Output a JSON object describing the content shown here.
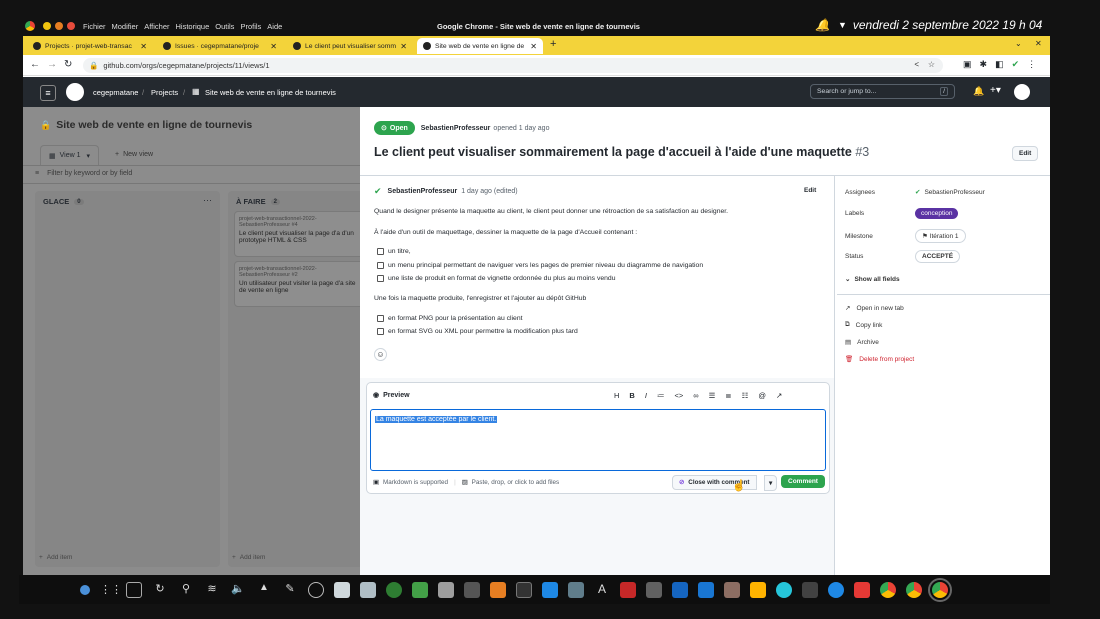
{
  "system": {
    "menu": [
      "Fichier",
      "Modifier",
      "Afficher",
      "Historique",
      "Outils",
      "Profils",
      "Aide"
    ],
    "window_title": "Google Chrome - Site web de vente en ligne de tournevis",
    "clock": "vendredi 2 septembre 2022  19 h 04"
  },
  "tabs": [
    {
      "label": "Projects · projet-web-transac"
    },
    {
      "label": "Issues · cegepmatane/proje"
    },
    {
      "label": "Le client peut visualiser somm"
    },
    {
      "label": "Site web de vente en ligne de"
    }
  ],
  "url": "github.com/orgs/cegepmatane/projects/11/views/1",
  "github": {
    "org": "cegepmatane",
    "crumb_projects": "Projects",
    "project_name": "Site web de vente en ligne de tournevis",
    "search_placeholder": "Search or jump to...",
    "search_key": "/"
  },
  "board": {
    "title": "Site web de vente en ligne de tournevis",
    "view_tab": "View 1",
    "new_view": "New view",
    "filter_placeholder": "Filter by keyword or by field",
    "columns": [
      {
        "name": "GLACE",
        "count": "0",
        "more": "···"
      },
      {
        "name": "À FAIRE",
        "count": "2"
      }
    ],
    "cards": [
      {
        "ref": "projet-web-transactionnel-2022-SebastienProfesseur #4",
        "title": "Le client peut visualiser la page d'a d'un prototype HTML & CSS"
      },
      {
        "ref": "projet-web-transactionnel-2022-SebastienProfesseur #2",
        "title": "Un utilisateur peut visiter la page d'a site de vente en ligne"
      }
    ],
    "add_item": "Add item"
  },
  "issue": {
    "state": "Open",
    "author": "SebastienProfesseur",
    "opened": "opened 1 day ago",
    "title": "Le client peut visualiser sommairement la page d'accueil à l'aide d'une maquette",
    "number": "#3",
    "edit": "Edit",
    "comment_author": "SebastienProfesseur",
    "comment_meta": "1 day ago (edited)",
    "comment_edit": "Edit",
    "body_intro": "Quand le designer présente la maquette au client, le client peut donner une rétroaction de sa satisfaction au designer.",
    "body_list_intro": "À l'aide d'un outil de maquettage, dessiner la maquette de la page d'Accueil contenant :",
    "tasks1": [
      "un titre,",
      "un menu principal permettant de naviguer vers les pages de premier niveau du diagramme de navigation",
      "une liste de produit en format de vignette ordonnée du plus au moins vendu"
    ],
    "body_after": "Une fois la maquette produite, l'enregistrer et l'ajouter au dépôt GitHub",
    "tasks2": [
      "en format PNG pour la présentation au client",
      "en format SVG ou XML pour permettre la modification plus tard"
    ]
  },
  "composer": {
    "tab": "Preview",
    "toolbar": [
      "H",
      "B",
      "I"
    ],
    "text": "La maquette est acceptée par le client.",
    "markdown_note": "Markdown is supported",
    "attach_note": "Paste, drop, or click to add files",
    "close_btn": "Close with comment",
    "comment_btn": "Comment"
  },
  "sidebar": {
    "fields": [
      {
        "key": "Assignees",
        "value": "SebastienProfesseur"
      },
      {
        "key": "Labels",
        "value": "conception"
      },
      {
        "key": "Milestone",
        "value": "Itération 1"
      },
      {
        "key": "Status",
        "value": "ACCEPTÉ"
      }
    ],
    "show_all": "Show all fields",
    "actions": [
      "Open in new tab",
      "Copy link",
      "Archive"
    ],
    "delete": "Delete from project"
  },
  "colors": {
    "tab_strip": "#f3d33a",
    "open_green": "#2da44e",
    "label_purple": "#5a32a3",
    "danger": "#cf222e"
  }
}
